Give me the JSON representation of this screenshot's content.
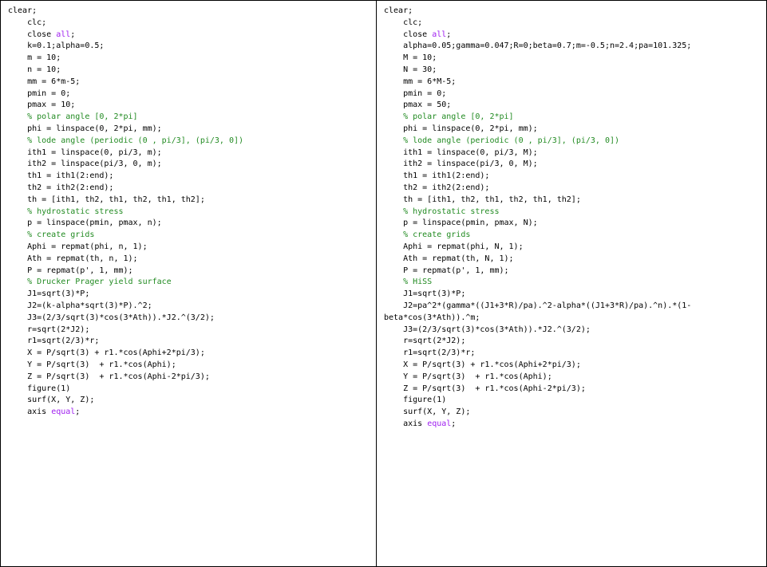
{
  "left": {
    "lines": [
      [
        {
          "t": "clear;"
        }
      ],
      [
        {
          "t": "    clc;"
        }
      ],
      [
        {
          "t": "    close "
        },
        {
          "t": "all",
          "k": "keyword"
        },
        {
          "t": ";"
        }
      ],
      [
        {
          "t": "    k=0.1;alpha=0.5;"
        }
      ],
      [
        {
          "t": "    m = 10;"
        }
      ],
      [
        {
          "t": "    n = 10;"
        }
      ],
      [
        {
          "t": "    mm = 6*m-5;"
        }
      ],
      [
        {
          "t": "    pmin = 0;"
        }
      ],
      [
        {
          "t": "    pmax = 10;"
        }
      ],
      [
        {
          "t": "    % polar angle [0, 2*pi]",
          "k": "comment"
        }
      ],
      [
        {
          "t": "    phi = linspace(0, 2*pi, mm);"
        }
      ],
      [
        {
          "t": "    % lode angle (periodic (0 , pi/3], (pi/3, 0])",
          "k": "comment"
        }
      ],
      [
        {
          "t": "    ith1 = linspace(0, pi/3, m);"
        }
      ],
      [
        {
          "t": "    ith2 = linspace(pi/3, 0, m);"
        }
      ],
      [
        {
          "t": "    th1 = ith1(2:end);"
        }
      ],
      [
        {
          "t": "    th2 = ith2(2:end);"
        }
      ],
      [
        {
          "t": "    th = [ith1, th2, th1, th2, th1, th2];"
        }
      ],
      [
        {
          "t": "    % hydrostatic stress",
          "k": "comment"
        }
      ],
      [
        {
          "t": "    p = linspace(pmin, pmax, n);"
        }
      ],
      [
        {
          "t": "    % create grids",
          "k": "comment"
        }
      ],
      [
        {
          "t": "    Aphi = repmat(phi, n, 1);"
        }
      ],
      [
        {
          "t": "    Ath = repmat(th, n, 1);"
        }
      ],
      [
        {
          "t": "    P = repmat(p', 1, mm);"
        }
      ],
      [
        {
          "t": "    % Drucker Prager yield surface",
          "k": "comment"
        }
      ],
      [
        {
          "t": "    J1=sqrt(3)*P;"
        }
      ],
      [
        {
          "t": "    J2=(k-alpha*sqrt(3)*P).^2;"
        }
      ],
      [
        {
          "t": "    J3=(2/3/sqrt(3)*cos(3*Ath)).*J2.^(3/2);"
        }
      ],
      [
        {
          "t": "    r=sqrt(2*J2);"
        }
      ],
      [
        {
          "t": "    r1=sqrt(2/3)*r;"
        }
      ],
      [
        {
          "t": "    X = P/sqrt(3) + r1.*cos(Aphi+2*pi/3);"
        }
      ],
      [
        {
          "t": "    Y = P/sqrt(3)  + r1.*cos(Aphi);"
        }
      ],
      [
        {
          "t": "    Z = P/sqrt(3)  + r1.*cos(Aphi-2*pi/3);"
        }
      ],
      [
        {
          "t": "    figure(1)"
        }
      ],
      [
        {
          "t": "    surf(X, Y, Z);"
        }
      ],
      [
        {
          "t": "    axis "
        },
        {
          "t": "equal",
          "k": "keyword"
        },
        {
          "t": ";"
        }
      ]
    ]
  },
  "right": {
    "lines": [
      [
        {
          "t": "clear;"
        }
      ],
      [
        {
          "t": "    clc;"
        }
      ],
      [
        {
          "t": "    close "
        },
        {
          "t": "all",
          "k": "keyword"
        },
        {
          "t": ";"
        }
      ],
      [
        {
          "t": "    alpha=0.05;gamma=0.047;R=0;beta=0.7;m=-0.5;n=2.4;pa=101.325;"
        }
      ],
      [
        {
          "t": "    M = 10;"
        }
      ],
      [
        {
          "t": "    N = 30;"
        }
      ],
      [
        {
          "t": "    mm = 6*M-5;"
        }
      ],
      [
        {
          "t": "    pmin = 0;"
        }
      ],
      [
        {
          "t": "    pmax = 50;"
        }
      ],
      [
        {
          "t": "    % polar angle [0, 2*pi]",
          "k": "comment"
        }
      ],
      [
        {
          "t": "    phi = linspace(0, 2*pi, mm);"
        }
      ],
      [
        {
          "t": "    % lode angle (periodic (0 , pi/3], (pi/3, 0])",
          "k": "comment"
        }
      ],
      [
        {
          "t": "    ith1 = linspace(0, pi/3, M);"
        }
      ],
      [
        {
          "t": "    ith2 = linspace(pi/3, 0, M);"
        }
      ],
      [
        {
          "t": "    th1 = ith1(2:end);"
        }
      ],
      [
        {
          "t": "    th2 = ith2(2:end);"
        }
      ],
      [
        {
          "t": "    th = [ith1, th2, th1, th2, th1, th2];"
        }
      ],
      [
        {
          "t": "    % hydrostatic stress",
          "k": "comment"
        }
      ],
      [
        {
          "t": "    p = linspace(pmin, pmax, N);"
        }
      ],
      [
        {
          "t": "    % create grids",
          "k": "comment"
        }
      ],
      [
        {
          "t": "    Aphi = repmat(phi, N, 1);"
        }
      ],
      [
        {
          "t": "    Ath = repmat(th, N, 1);"
        }
      ],
      [
        {
          "t": "    P = repmat(p', 1, mm);"
        }
      ],
      [
        {
          "t": "    % HiSS",
          "k": "comment"
        }
      ],
      [
        {
          "t": "    J1=sqrt(3)*P;"
        }
      ],
      [
        {
          "t": "    J2=pa^2*(gamma*((J1+3*R)/pa).^2-alpha*((J1+3*R)/pa).^n).*(1-"
        }
      ],
      [
        {
          "t": "beta*cos(3*Ath)).^m;"
        }
      ],
      [
        {
          "t": "    J3=(2/3/sqrt(3)*cos(3*Ath)).*J2.^(3/2);"
        }
      ],
      [
        {
          "t": "    r=sqrt(2*J2);"
        }
      ],
      [
        {
          "t": "    r1=sqrt(2/3)*r;"
        }
      ],
      [
        {
          "t": "    X = P/sqrt(3) + r1.*cos(Aphi+2*pi/3);"
        }
      ],
      [
        {
          "t": "    Y = P/sqrt(3)  + r1.*cos(Aphi);"
        }
      ],
      [
        {
          "t": "    Z = P/sqrt(3)  + r1.*cos(Aphi-2*pi/3);"
        }
      ],
      [
        {
          "t": "    figure(1)"
        }
      ],
      [
        {
          "t": "    surf(X, Y, Z);"
        }
      ],
      [
        {
          "t": "    axis "
        },
        {
          "t": "equal",
          "k": "keyword"
        },
        {
          "t": ";"
        }
      ]
    ]
  }
}
